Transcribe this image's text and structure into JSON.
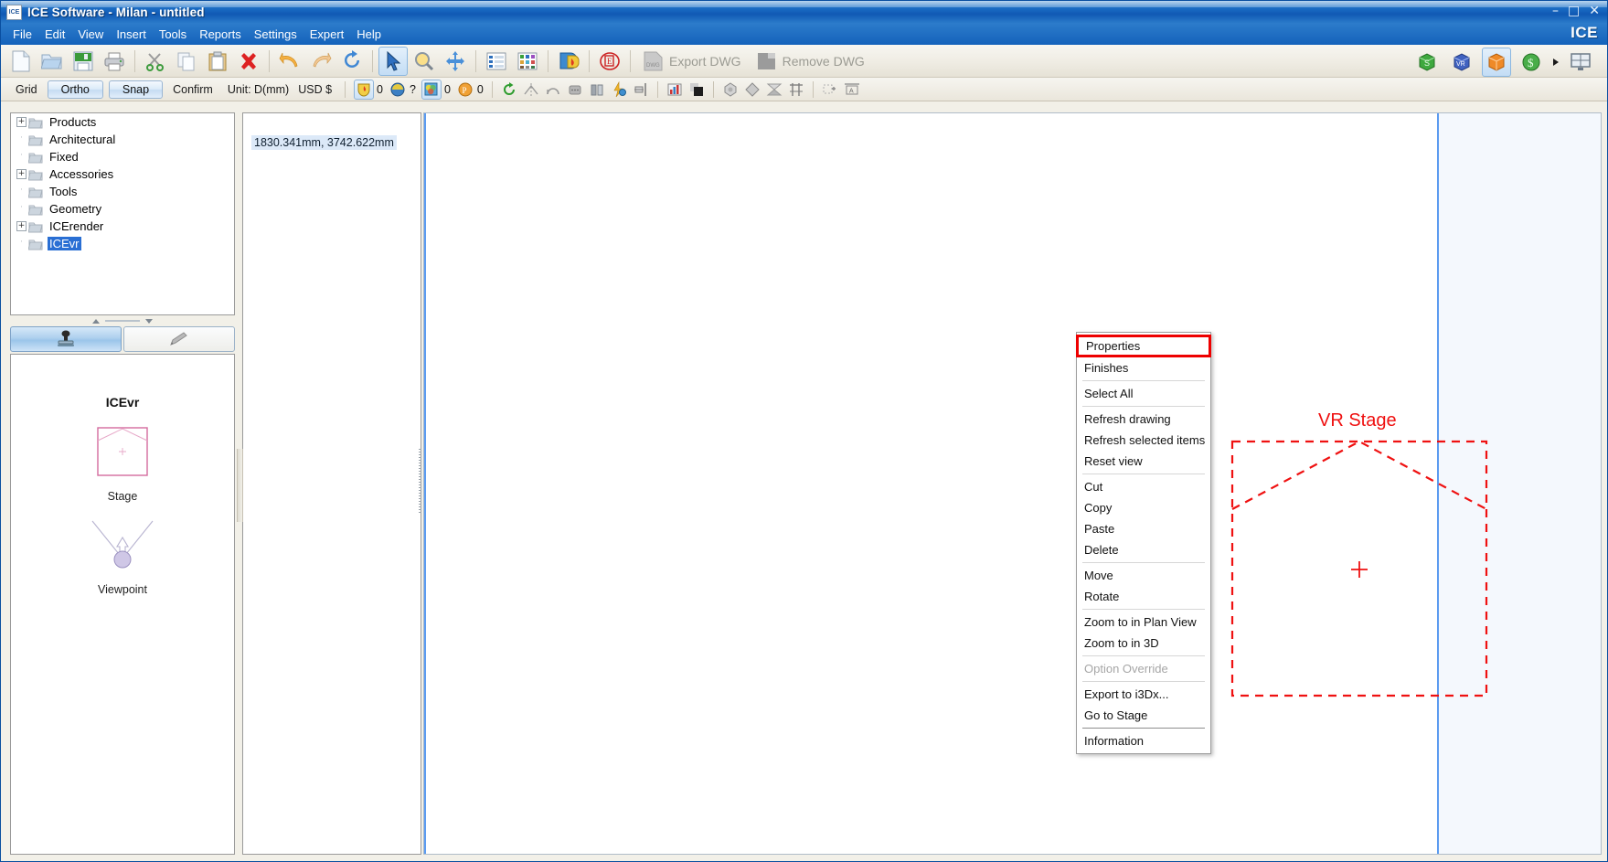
{
  "window": {
    "title": "ICE Software - Milan - untitled",
    "app_icon": "ICE",
    "brand": "ICE",
    "minimize": "–",
    "maximize": "□",
    "close": "✕"
  },
  "menubar": {
    "items": [
      "File",
      "Edit",
      "View",
      "Insert",
      "Tools",
      "Reports",
      "Settings",
      "Expert",
      "Help"
    ]
  },
  "toolbar_main": {
    "buttons": [
      {
        "name": "new-document-icon",
        "label": "New"
      },
      {
        "name": "open-folder-icon",
        "label": "Open"
      },
      {
        "name": "save-icon",
        "label": "Save"
      },
      {
        "name": "print-icon",
        "label": "Print"
      },
      {
        "name": "cut-scissors-icon",
        "label": "Cut"
      },
      {
        "name": "copy-icon",
        "label": "Copy"
      },
      {
        "name": "paste-clipboard-icon",
        "label": "Paste"
      },
      {
        "name": "delete-x-icon",
        "label": "Delete"
      },
      {
        "name": "undo-arrow-icon",
        "label": "Undo"
      },
      {
        "name": "redo-arrow-icon",
        "label": "Redo"
      },
      {
        "name": "refresh-circular-icon",
        "label": "Refresh"
      },
      {
        "name": "select-pointer-icon",
        "label": "Select",
        "active": true
      },
      {
        "name": "zoom-magnifier-icon",
        "label": "Zoom"
      },
      {
        "name": "pan-move-icon",
        "label": "Pan"
      },
      {
        "name": "list-view-icon",
        "label": "List view"
      },
      {
        "name": "grid-view-icon",
        "label": "Grid view"
      },
      {
        "name": "shield-flame-icon",
        "label": "Fire shield"
      },
      {
        "name": "stamp-red-icon",
        "label": "Stamp"
      }
    ],
    "export_dwg_label": "Export DWG",
    "remove_dwg_label": "Remove DWG",
    "right_icons": [
      {
        "name": "sketchup-green-cube-icon",
        "label": "S"
      },
      {
        "name": "vr-blue-cube-icon",
        "label": "VR"
      },
      {
        "name": "orange-cube-icon",
        "label": "3D",
        "active": true
      },
      {
        "name": "dollar-green-circle-icon",
        "label": "$"
      },
      {
        "name": "overflow-chevron-icon",
        "label": "▸"
      },
      {
        "name": "monitor-display-icon",
        "label": "Display"
      }
    ]
  },
  "toolbar_options": {
    "grid_label": "Grid",
    "ortho_label": "Ortho",
    "snap_label": "Snap",
    "confirm_label": "Confirm",
    "unit_label": "Unit: D(mm)",
    "currency_label": "USD $",
    "counters": [
      {
        "name": "fire-shield-counter",
        "value": "0",
        "framed": true
      },
      {
        "name": "acoustics-counter",
        "value": "?",
        "framed": false
      },
      {
        "name": "lighting-counter",
        "value": "0",
        "framed": true
      },
      {
        "name": "power-counter",
        "value": "0",
        "framed": false
      }
    ],
    "tools": [
      {
        "name": "rotate-green-icon"
      },
      {
        "name": "mirror-icon"
      },
      {
        "name": "arc-icon"
      },
      {
        "name": "panel-icon"
      },
      {
        "name": "wall-panel-icon"
      },
      {
        "name": "lightning-bolt-icon"
      },
      {
        "name": "align-left-icon"
      },
      {
        "name": "chart-bars-icon"
      },
      {
        "name": "shade-cube-icon"
      },
      {
        "name": "hex-shape-icon"
      },
      {
        "name": "diamond-shape-icon"
      },
      {
        "name": "triangle-pair-icon"
      },
      {
        "name": "truss-icon"
      },
      {
        "name": "insert-view-icon"
      },
      {
        "name": "annotate-text-icon"
      }
    ]
  },
  "sidebar": {
    "tree": [
      {
        "label": "Products",
        "expandable": true,
        "selected": false
      },
      {
        "label": "Architectural",
        "expandable": false,
        "selected": false
      },
      {
        "label": "Fixed",
        "expandable": false,
        "selected": false
      },
      {
        "label": "Accessories",
        "expandable": true,
        "selected": false
      },
      {
        "label": "Tools",
        "expandable": false,
        "selected": false
      },
      {
        "label": "Geometry",
        "expandable": false,
        "selected": false
      },
      {
        "label": "ICErender",
        "expandable": true,
        "selected": false
      },
      {
        "label": "ICEvr",
        "expandable": false,
        "selected": true
      }
    ],
    "tabs": [
      {
        "name": "stamp-tab",
        "icon": "stamp-icon",
        "active": true
      },
      {
        "name": "pencil-tab",
        "icon": "pencil-icon",
        "active": false
      }
    ],
    "preview": {
      "title": "ICEvr",
      "items": [
        {
          "label": "Stage",
          "icon": "stage-outline-icon"
        },
        {
          "label": "Viewpoint",
          "icon": "viewpoint-cone-icon"
        }
      ]
    }
  },
  "readout": {
    "coordinates": "1830.341mm, 3742.622mm"
  },
  "canvas": {
    "drawing_title": "VR Stage",
    "stage_color": "#ef1111",
    "center_marker": "crosshair-icon"
  },
  "context_menu": {
    "items": [
      {
        "label": "Properties",
        "highlight": true,
        "disabled": false
      },
      {
        "label": "Finishes",
        "disabled": false
      },
      {
        "sep": true
      },
      {
        "label": "Select All",
        "disabled": false
      },
      {
        "sep": true
      },
      {
        "label": "Refresh drawing",
        "disabled": false
      },
      {
        "label": "Refresh selected items",
        "disabled": false
      },
      {
        "label": "Reset view",
        "disabled": false
      },
      {
        "sep": true
      },
      {
        "label": "Cut",
        "disabled": false
      },
      {
        "label": "Copy",
        "disabled": false
      },
      {
        "label": "Paste",
        "disabled": false
      },
      {
        "label": "Delete",
        "disabled": false
      },
      {
        "sep": true
      },
      {
        "label": "Move",
        "disabled": false
      },
      {
        "label": "Rotate",
        "disabled": false
      },
      {
        "sep": true
      },
      {
        "label": "Zoom to in Plan View",
        "disabled": false
      },
      {
        "label": "Zoom to in 3D",
        "disabled": false
      },
      {
        "sep": true
      },
      {
        "label": "Option Override",
        "disabled": true
      },
      {
        "sep": true
      },
      {
        "label": "Export to i3Dx...",
        "disabled": false
      },
      {
        "label": "Go to Stage",
        "disabled": false
      },
      {
        "sep": true,
        "strong": true
      },
      {
        "label": "Information",
        "disabled": false
      }
    ]
  },
  "colors": {
    "titlebar_blue": "#1868c0",
    "highlight_red": "#ee0000",
    "selection_blue": "#2a6fd4",
    "stage_red": "#ef1111"
  }
}
